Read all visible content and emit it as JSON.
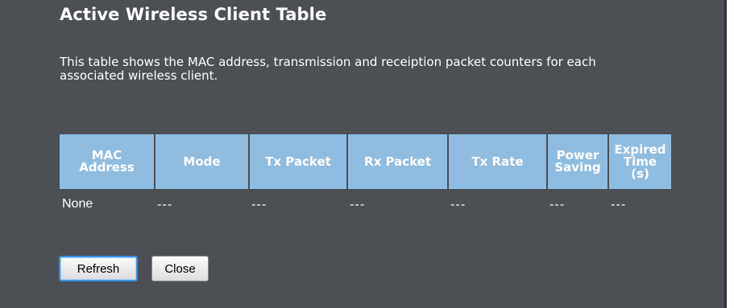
{
  "page": {
    "title": "Active Wireless Client Table",
    "description": "This table shows the MAC address, transmission and receiption packet counters for each associated wireless client."
  },
  "table": {
    "headers": {
      "mac_line1": "MAC",
      "mac_line2": "Address",
      "mode": "Mode",
      "tx_packet": "Tx Packet",
      "rx_packet": "Rx Packet",
      "tx_rate": "Tx Rate",
      "power_line1": "Power",
      "power_line2": "Saving",
      "expired_line1": "Expired",
      "expired_line2": "Time",
      "expired_line3": "(s)"
    },
    "rows": [
      {
        "mac": "None",
        "mode": "---",
        "tx_packet": "---",
        "rx_packet": "---",
        "tx_rate": "---",
        "power_saving": "---",
        "expired_time": "---"
      }
    ]
  },
  "buttons": {
    "refresh": "Refresh",
    "close": "Close"
  },
  "colors": {
    "background": "#4c4f54",
    "header_bg": "#8fbde2",
    "text": "#ffffff",
    "focus_border": "#3d8fe0"
  }
}
